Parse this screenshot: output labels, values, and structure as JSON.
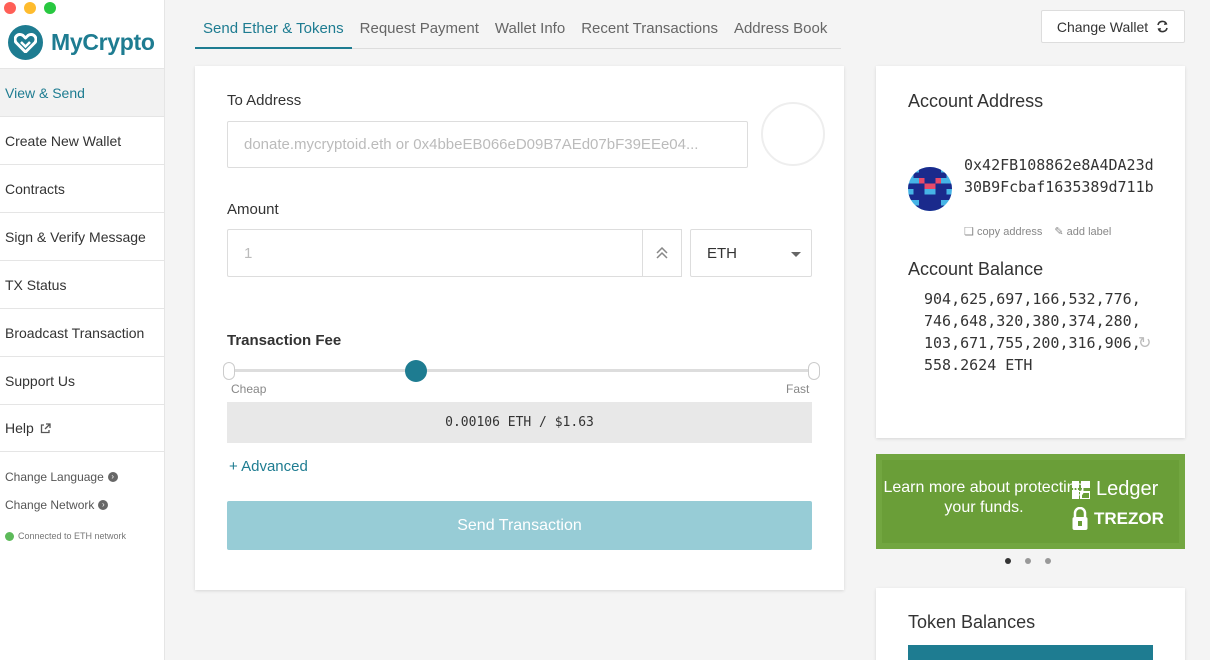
{
  "app": {
    "name": "MyCrypto"
  },
  "window_controls": {
    "close_color": "#ff5f57",
    "minimize_color": "#febc2e",
    "zoom_color": "#28c840"
  },
  "sidebar": {
    "items": [
      {
        "label": "View & Send",
        "active": true
      },
      {
        "label": "Create New Wallet"
      },
      {
        "label": "Contracts"
      },
      {
        "label": "Sign & Verify Message"
      },
      {
        "label": "TX Status"
      },
      {
        "label": "Broadcast Transaction"
      },
      {
        "label": "Support Us"
      },
      {
        "label": "Help",
        "icon": "external-link-icon"
      }
    ],
    "change_language": "Change Language",
    "change_network": "Change Network",
    "connection_status": "Connected to ETH network"
  },
  "tabs": [
    {
      "label": "Send Ether & Tokens",
      "active": true
    },
    {
      "label": "Request Payment"
    },
    {
      "label": "Wallet Info"
    },
    {
      "label": "Recent Transactions"
    },
    {
      "label": "Address Book"
    }
  ],
  "header": {
    "change_wallet_label": "Change Wallet",
    "change_wallet_icon": "refresh-icon"
  },
  "send_form": {
    "to_address_label": "To Address",
    "to_address_placeholder": "donate.mycryptoid.eth or 0x4bbeEB066eD09B7AEd07bF39EEe04...",
    "amount_label": "Amount",
    "amount_placeholder": "1",
    "currency": "ETH",
    "fee_label": "Transaction Fee",
    "fee_slider_position": 0.32,
    "fee_cheap_label": "Cheap",
    "fee_fast_label": "Fast",
    "fee_value": "0.00106 ETH / $1.63",
    "advanced_label": "+ Advanced",
    "send_button_label": "Send Transaction"
  },
  "account": {
    "address_title": "Account Address",
    "address": "0x42FB108862e8A4DA23d30B9Fcbaf1635389d711b",
    "copy_address_label": "copy address",
    "add_label_label": "add label",
    "balance_title": "Account Balance",
    "balance": "904,625,697,166,532,776,746,648,320,380,374,280,103,671,755,200,316,906,558.2624 ETH"
  },
  "promo": {
    "text": "Learn more about protecting your funds.",
    "brand_1": "Ledger",
    "brand_2": "TREZOR"
  },
  "token_balances": {
    "title": "Token Balances"
  },
  "colors": {
    "accent": "#1e7c91",
    "send_disabled": "#97ccd6",
    "promo_green": "#72a640"
  }
}
